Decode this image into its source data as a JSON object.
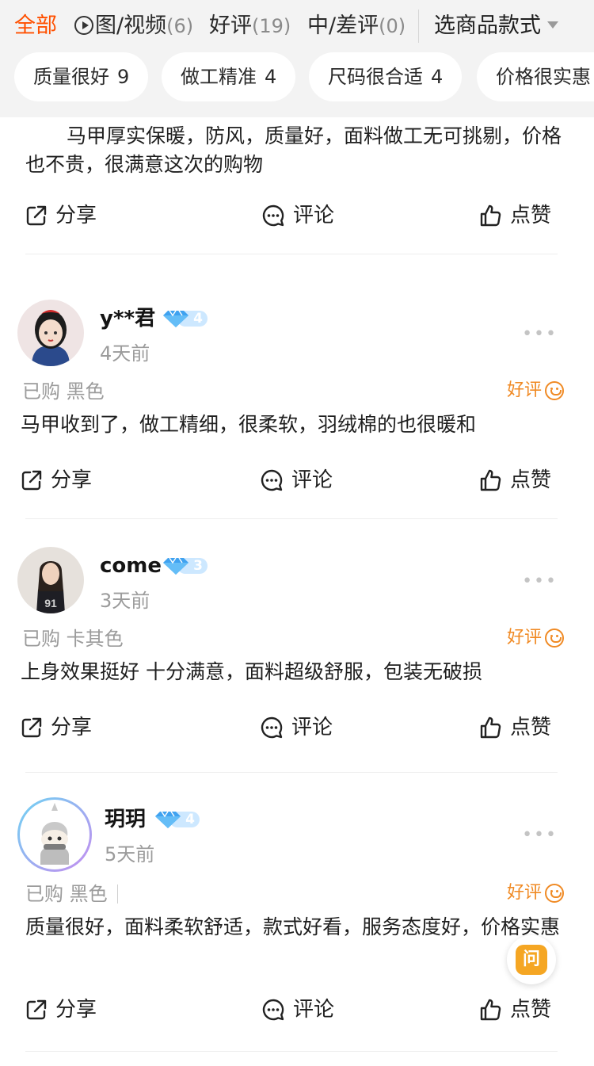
{
  "filter": {
    "tabs": [
      {
        "label": "全部",
        "count": ""
      },
      {
        "label": "图/视频",
        "count": "(6)"
      },
      {
        "label": "好评",
        "count": "(19)"
      },
      {
        "label": "中/差评",
        "count": "(0)"
      }
    ],
    "style_select": "选商品款式",
    "chips": [
      {
        "label": "质量很好",
        "count": "9"
      },
      {
        "label": "做工精准",
        "count": "4"
      },
      {
        "label": "尺码很合适",
        "count": "4"
      },
      {
        "label": "价格很实惠",
        "count": ""
      }
    ],
    "colors": {
      "active": "#ff5000",
      "background": "#f3f3f3"
    }
  },
  "actions": {
    "share": "分享",
    "comment": "评论",
    "like": "点赞"
  },
  "reviews": [
    {
      "text": "马甲厚实保暖，防风，质量好，面料做工无可挑剔，价格也不贵，很满意这次的购物"
    },
    {
      "user": "y**君",
      "level": "4",
      "time": "4天前",
      "purchased": "已购 黑色",
      "rating": "好评",
      "text": "马甲收到了，做工精细，很柔软，羽绒棉的也很暖和"
    },
    {
      "user": "come",
      "level": "3",
      "time": "3天前",
      "purchased": "已购 卡其色",
      "rating": "好评",
      "text": "上身效果挺好 十分满意，面料超级舒服，包装无破损"
    },
    {
      "user": "玥玥",
      "level": "4",
      "time": "5天前",
      "purchased": "已购 黑色",
      "rating": "好评",
      "text": "质量很好，面料柔软舒适，款式好看，服务态度好，价格实惠"
    }
  ],
  "more_glyph": "•••",
  "ask_button": "问"
}
